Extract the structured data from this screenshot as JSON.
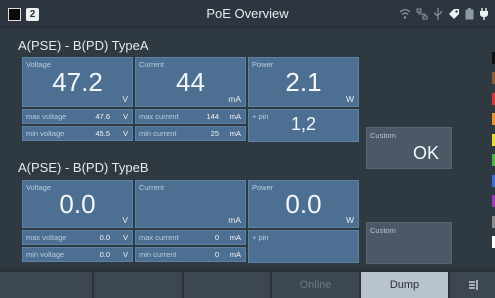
{
  "title": "PoE Overview",
  "badge": "2",
  "section_a": {
    "title": "A(PSE) - B(PD) TypeA",
    "voltage": {
      "label": "Voltage",
      "value": "47.2",
      "unit": "V"
    },
    "current": {
      "label": "Current",
      "value": "44",
      "unit": "mA"
    },
    "power": {
      "label": "Power",
      "value": "2.1",
      "unit": "W"
    },
    "max_voltage": {
      "label": "max voltage",
      "value": "47.6",
      "unit": "V"
    },
    "min_voltage": {
      "label": "min voltage",
      "value": "45.5",
      "unit": "V"
    },
    "max_current": {
      "label": "max current",
      "value": "144",
      "unit": "mA"
    },
    "min_current": {
      "label": "min current",
      "value": "25",
      "unit": "mA"
    },
    "pin": {
      "label": "+ pin",
      "value": "1,2"
    },
    "custom": {
      "label": "Custom",
      "value": "OK"
    }
  },
  "section_b": {
    "title": "A(PSE) - B(PD) TypeB",
    "voltage": {
      "label": "Voltage",
      "value": "0.0",
      "unit": "V"
    },
    "current": {
      "label": "Current",
      "value": "",
      "unit": "mA"
    },
    "power": {
      "label": "Power",
      "value": "0.0",
      "unit": "W"
    },
    "max_voltage": {
      "label": "max voltage",
      "value": "0.0",
      "unit": "V"
    },
    "min_voltage": {
      "label": "min voltage",
      "value": "0.0",
      "unit": "V"
    },
    "max_current": {
      "label": "max current",
      "value": "0",
      "unit": "mA"
    },
    "min_current": {
      "label": "min current",
      "value": "0",
      "unit": "mA"
    },
    "pin": {
      "label": "+ pin",
      "value": ""
    },
    "custom": {
      "label": "Custom",
      "value": ""
    }
  },
  "bottom": {
    "online": "Online",
    "dump": "Dump",
    "menu_icon": "menu-icon"
  },
  "color_strip": [
    "#111111",
    "#8a5a3a",
    "#d23b3b",
    "#e8922e",
    "#e9d83a",
    "#55b04a",
    "#3f6fd0",
    "#9a3fb5",
    "#8c8c8c",
    "#ffffff"
  ],
  "icons": [
    "wifi-icon",
    "network-icon",
    "usb-icon",
    "tag-icon",
    "battery-icon",
    "plug-icon"
  ]
}
